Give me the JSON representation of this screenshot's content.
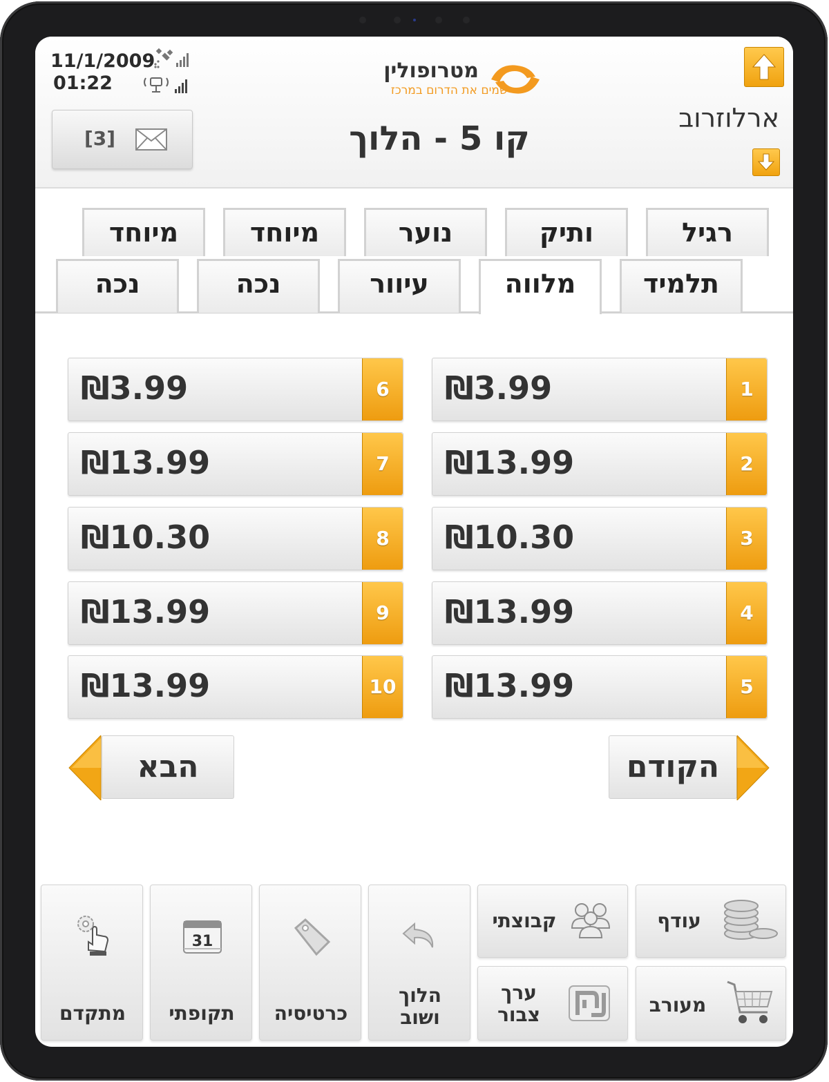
{
  "status": {
    "date": "11/1/2009",
    "time": "01:22"
  },
  "mail": {
    "count": "[3]"
  },
  "logo": {
    "name": "מטרופולין",
    "tagline": "שמים את הדרום במרכז"
  },
  "header": {
    "title": "קו 5 - הלוך",
    "route": "ארלוזרוב"
  },
  "tabs_top": [
    "רגיל",
    "ותיק",
    "נוער",
    "מיוחד",
    "מיוחד"
  ],
  "tabs_bottom": [
    "תלמיד",
    "מלווה",
    "עיוור",
    "נכה",
    "נכה"
  ],
  "active_tab": "מלווה",
  "fares": [
    {
      "num": "1",
      "price": "₪3.99"
    },
    {
      "num": "2",
      "price": "₪13.99"
    },
    {
      "num": "3",
      "price": "₪10.30"
    },
    {
      "num": "4",
      "price": "₪13.99"
    },
    {
      "num": "5",
      "price": "₪13.99"
    },
    {
      "num": "6",
      "price": "₪3.99"
    },
    {
      "num": "7",
      "price": "₪13.99"
    },
    {
      "num": "8",
      "price": "₪10.30"
    },
    {
      "num": "9",
      "price": "₪13.99"
    },
    {
      "num": "10",
      "price": "₪13.99"
    }
  ],
  "pager": {
    "prev_label": "הקודם",
    "next_label": "הבא"
  },
  "toolbar": {
    "change": "עודף",
    "group": "קבוצתי",
    "cart": "מעורב",
    "stored_value_line1": "ערך",
    "stored_value_line2": "צבור",
    "return_line1": "הלוך",
    "return_line2": "ושוב",
    "cards": "כרטיסיה",
    "periodic": "תקופתי",
    "calendar_day": "31",
    "advanced": "מתקדם"
  },
  "colors": {
    "accent": "#f0a20f",
    "accent_light": "#ffc94d",
    "text": "#333333"
  }
}
